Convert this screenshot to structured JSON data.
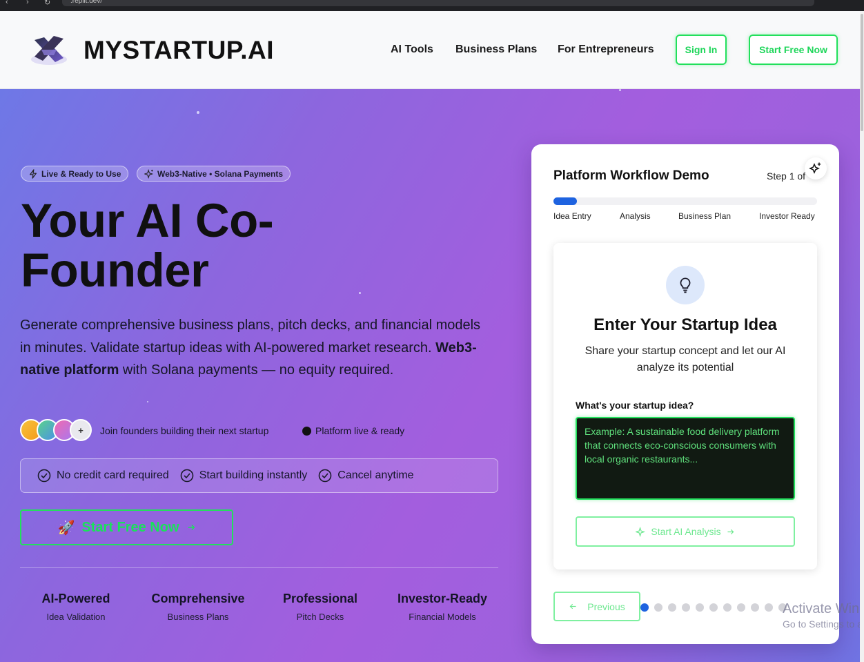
{
  "browser": {
    "url": ".replit.dev/"
  },
  "header": {
    "brand": "MYSTARTUP.AI",
    "nav": [
      "AI Tools",
      "Business Plans",
      "For Entrepreneurs"
    ],
    "sign_in": "Sign In",
    "start_free": "Start Free Now"
  },
  "hero": {
    "badges": [
      "Live & Ready to Use",
      "Web3-Native • Solana Payments"
    ],
    "title": "Your AI Co-Founder",
    "desc_pre": "Generate comprehensive business plans, pitch decks, and financial models in minutes. Validate startup ideas with AI-powered market research.",
    "desc_bold": "Web3-native platform",
    "desc_post": "with Solana payments — no equity required.",
    "avatar_more": "+",
    "join_text": "Join founders building their next startup",
    "live_text": "Platform live & ready",
    "checks": [
      "No credit card required",
      "Start building instantly",
      "Cancel anytime"
    ],
    "cta": "Start Free Now",
    "cta_emoji": "🚀",
    "stats": [
      {
        "title": "AI-Powered",
        "sub": "Idea Validation"
      },
      {
        "title": "Comprehensive",
        "sub": "Business Plans"
      },
      {
        "title": "Professional",
        "sub": "Pitch Decks"
      },
      {
        "title": "Investor-Ready",
        "sub": "Financial Models"
      }
    ]
  },
  "demo": {
    "title": "Platform Workflow Demo",
    "step": "Step 1 of",
    "progress_fraction": 0.09,
    "stages": [
      "Idea Entry",
      "Analysis",
      "Business Plan",
      "Investor Ready"
    ],
    "card_title": "Enter Your Startup Idea",
    "card_sub": "Share your startup concept and let our AI analyze its potential",
    "field_label": "What's your startup idea?",
    "placeholder": "Example: A sustainable food delivery platform that connects eco-conscious consumers with local organic restaurants...",
    "analysis_button": "Start AI Analysis",
    "previous": "Previous",
    "total_steps": 11,
    "current_step_index": 0
  },
  "watermark": {
    "line1": "Activate Windows",
    "line2": "Go to Settings to activate Windows."
  },
  "colors": {
    "accent_green": "#22e05c",
    "accent_blue": "#1e63e0",
    "hero_purple": "#a35ede"
  }
}
